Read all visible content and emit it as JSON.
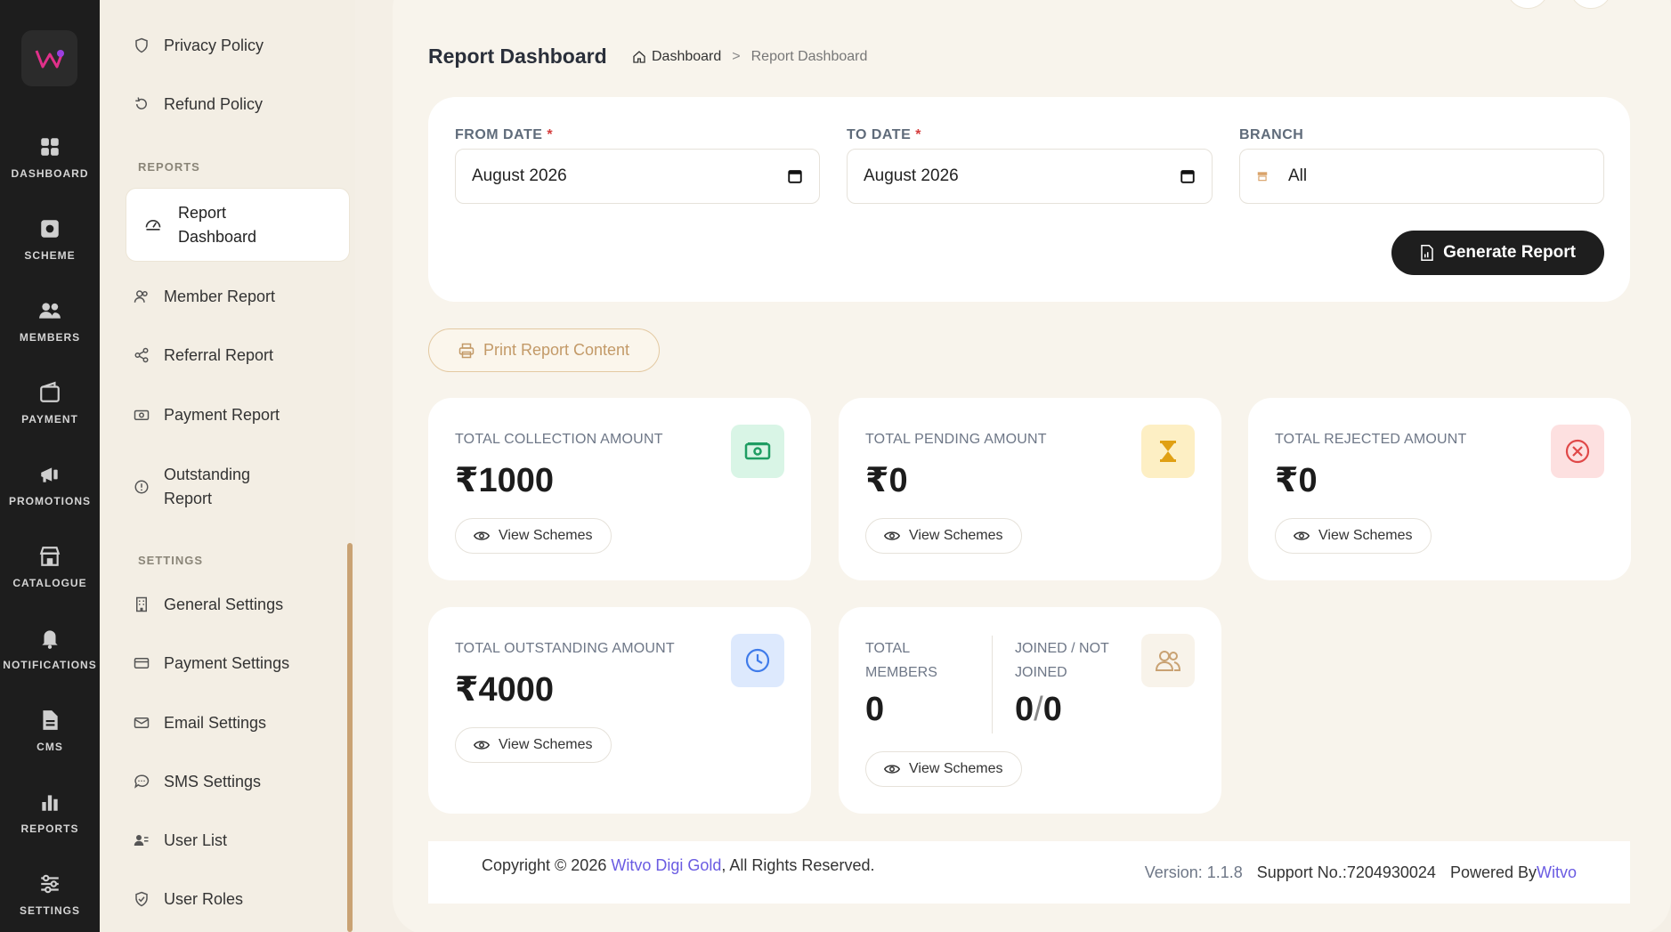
{
  "rail": {
    "items": [
      {
        "label": "DASHBOARD",
        "icon": "grid-icon"
      },
      {
        "label": "SCHEME",
        "icon": "safe-icon"
      },
      {
        "label": "MEMBERS",
        "icon": "users-icon"
      },
      {
        "label": "PAYMENT",
        "icon": "wallet-icon"
      },
      {
        "label": "PROMOTIONS",
        "icon": "megaphone-icon"
      },
      {
        "label": "CATALOGUE",
        "icon": "store-icon"
      },
      {
        "label": "NOTIFICATIONS",
        "icon": "bell-icon"
      },
      {
        "label": "CMS",
        "icon": "document-icon"
      },
      {
        "label": "REPORTS",
        "icon": "bar-chart-icon"
      },
      {
        "label": "SETTINGS",
        "icon": "sliders-icon"
      }
    ]
  },
  "sidebar": {
    "top_items": [
      {
        "label": "Privacy Policy",
        "icon": "shield-icon"
      },
      {
        "label": "Refund Policy",
        "icon": "refresh-icon"
      }
    ],
    "reports_heading": "REPORTS",
    "active_item": {
      "label": "Report Dashboard",
      "icon": "gauge-icon"
    },
    "report_items": [
      {
        "label": "Member Report",
        "icon": "users-icon"
      },
      {
        "label": "Referral Report",
        "icon": "share-icon"
      },
      {
        "label": "Payment Report",
        "icon": "cash-icon"
      },
      {
        "label": "Outstanding Report",
        "icon": "alert-circle-icon"
      }
    ],
    "settings_heading": "SETTINGS",
    "settings_items": [
      {
        "label": "General Settings",
        "icon": "building-icon"
      },
      {
        "label": "Payment Settings",
        "icon": "card-icon"
      },
      {
        "label": "Email Settings",
        "icon": "mail-icon"
      },
      {
        "label": "SMS Settings",
        "icon": "chat-icon"
      },
      {
        "label": "User List",
        "icon": "user-list-icon"
      },
      {
        "label": "User Roles",
        "icon": "shield-check-icon"
      }
    ]
  },
  "header": {
    "title": "Report Dashboard",
    "breadcrumb": {
      "home": "Dashboard",
      "separator": ">",
      "current": "Report Dashboard"
    }
  },
  "filters": {
    "from_label": "FROM DATE",
    "from_value": "August 2026",
    "to_label": "TO DATE",
    "to_value": "August 2026",
    "required_mark": "*",
    "branch_label": "BRANCH",
    "branch_value": "All",
    "generate_label": "Generate Report"
  },
  "print_label": "Print Report Content",
  "stats": {
    "collection": {
      "label": "TOTAL COLLECTION AMOUNT",
      "value": "₹1000",
      "view": "View Schemes",
      "icon_bg": "#d9f5e6",
      "icon_color": "#1f9d63"
    },
    "pending": {
      "label": "TOTAL PENDING AMOUNT",
      "value": "₹0",
      "view": "View Schemes",
      "icon_bg": "#fdefc4",
      "icon_color": "#e0a014"
    },
    "rejected": {
      "label": "TOTAL REJECTED AMOUNT",
      "value": "₹0",
      "view": "View Schemes",
      "icon_bg": "#fde0e0",
      "icon_color": "#e04848"
    },
    "outstanding": {
      "label": "TOTAL OUTSTANDING AMOUNT",
      "value": "₹4000",
      "view": "View Schemes",
      "icon_bg": "#dde9fd",
      "icon_color": "#3f7bea"
    },
    "members": {
      "total_label_1": "TOTAL",
      "total_label_2": "MEMBERS",
      "total_value": "0",
      "joined_label_1": "JOINED / NOT",
      "joined_label_2": "JOINED",
      "joined_value_a": "0",
      "joined_sep": "/",
      "joined_value_b": "0",
      "view": "View Schemes"
    }
  },
  "footer": {
    "copy_prefix": "Copyright © 2026 ",
    "company": "Witvo Digi Gold",
    "copy_suffix": ", All Rights Reserved.",
    "version": "Version: 1.1.8",
    "support": "Support No.:7204930024",
    "powered_prefix": "Powered By ",
    "powered_link": "Witvo"
  }
}
